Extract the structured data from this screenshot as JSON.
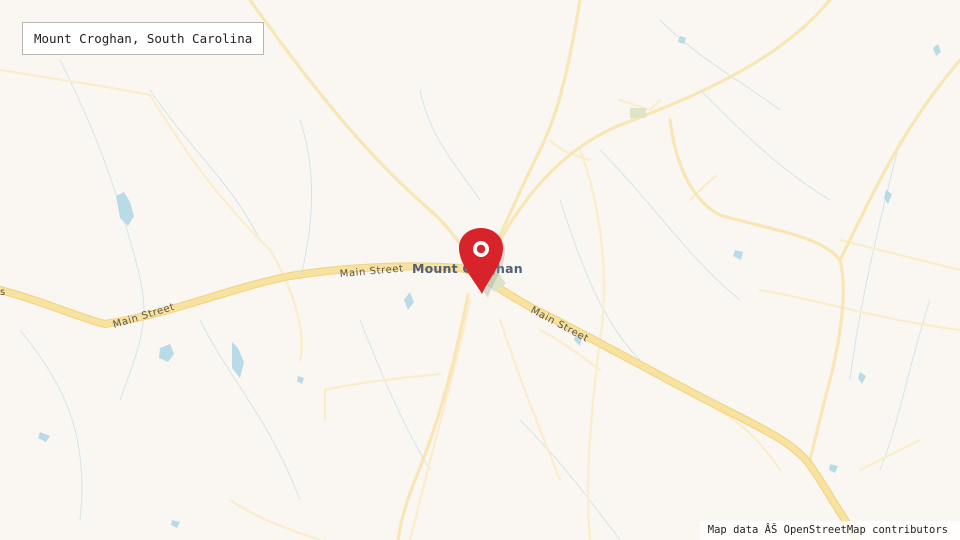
{
  "map": {
    "title": "Mount Croghan, South Carolina",
    "place_label": "Mount Croghan",
    "road_labels": [
      "Main Street",
      "Main Street",
      "Main Street"
    ],
    "edge_label": "s",
    "attribution": "Map data ÂŠ OpenStreetMap contributors",
    "marker_icon": "map-pin-icon",
    "colors": {
      "land": "#faf7f2",
      "major_road": "#f7e2a0",
      "minor_road": "#fbedcb",
      "water": "#b9dae7",
      "stream": "#c7dde8",
      "marker": "#d8232a",
      "place_label": "#4f6078"
    }
  }
}
